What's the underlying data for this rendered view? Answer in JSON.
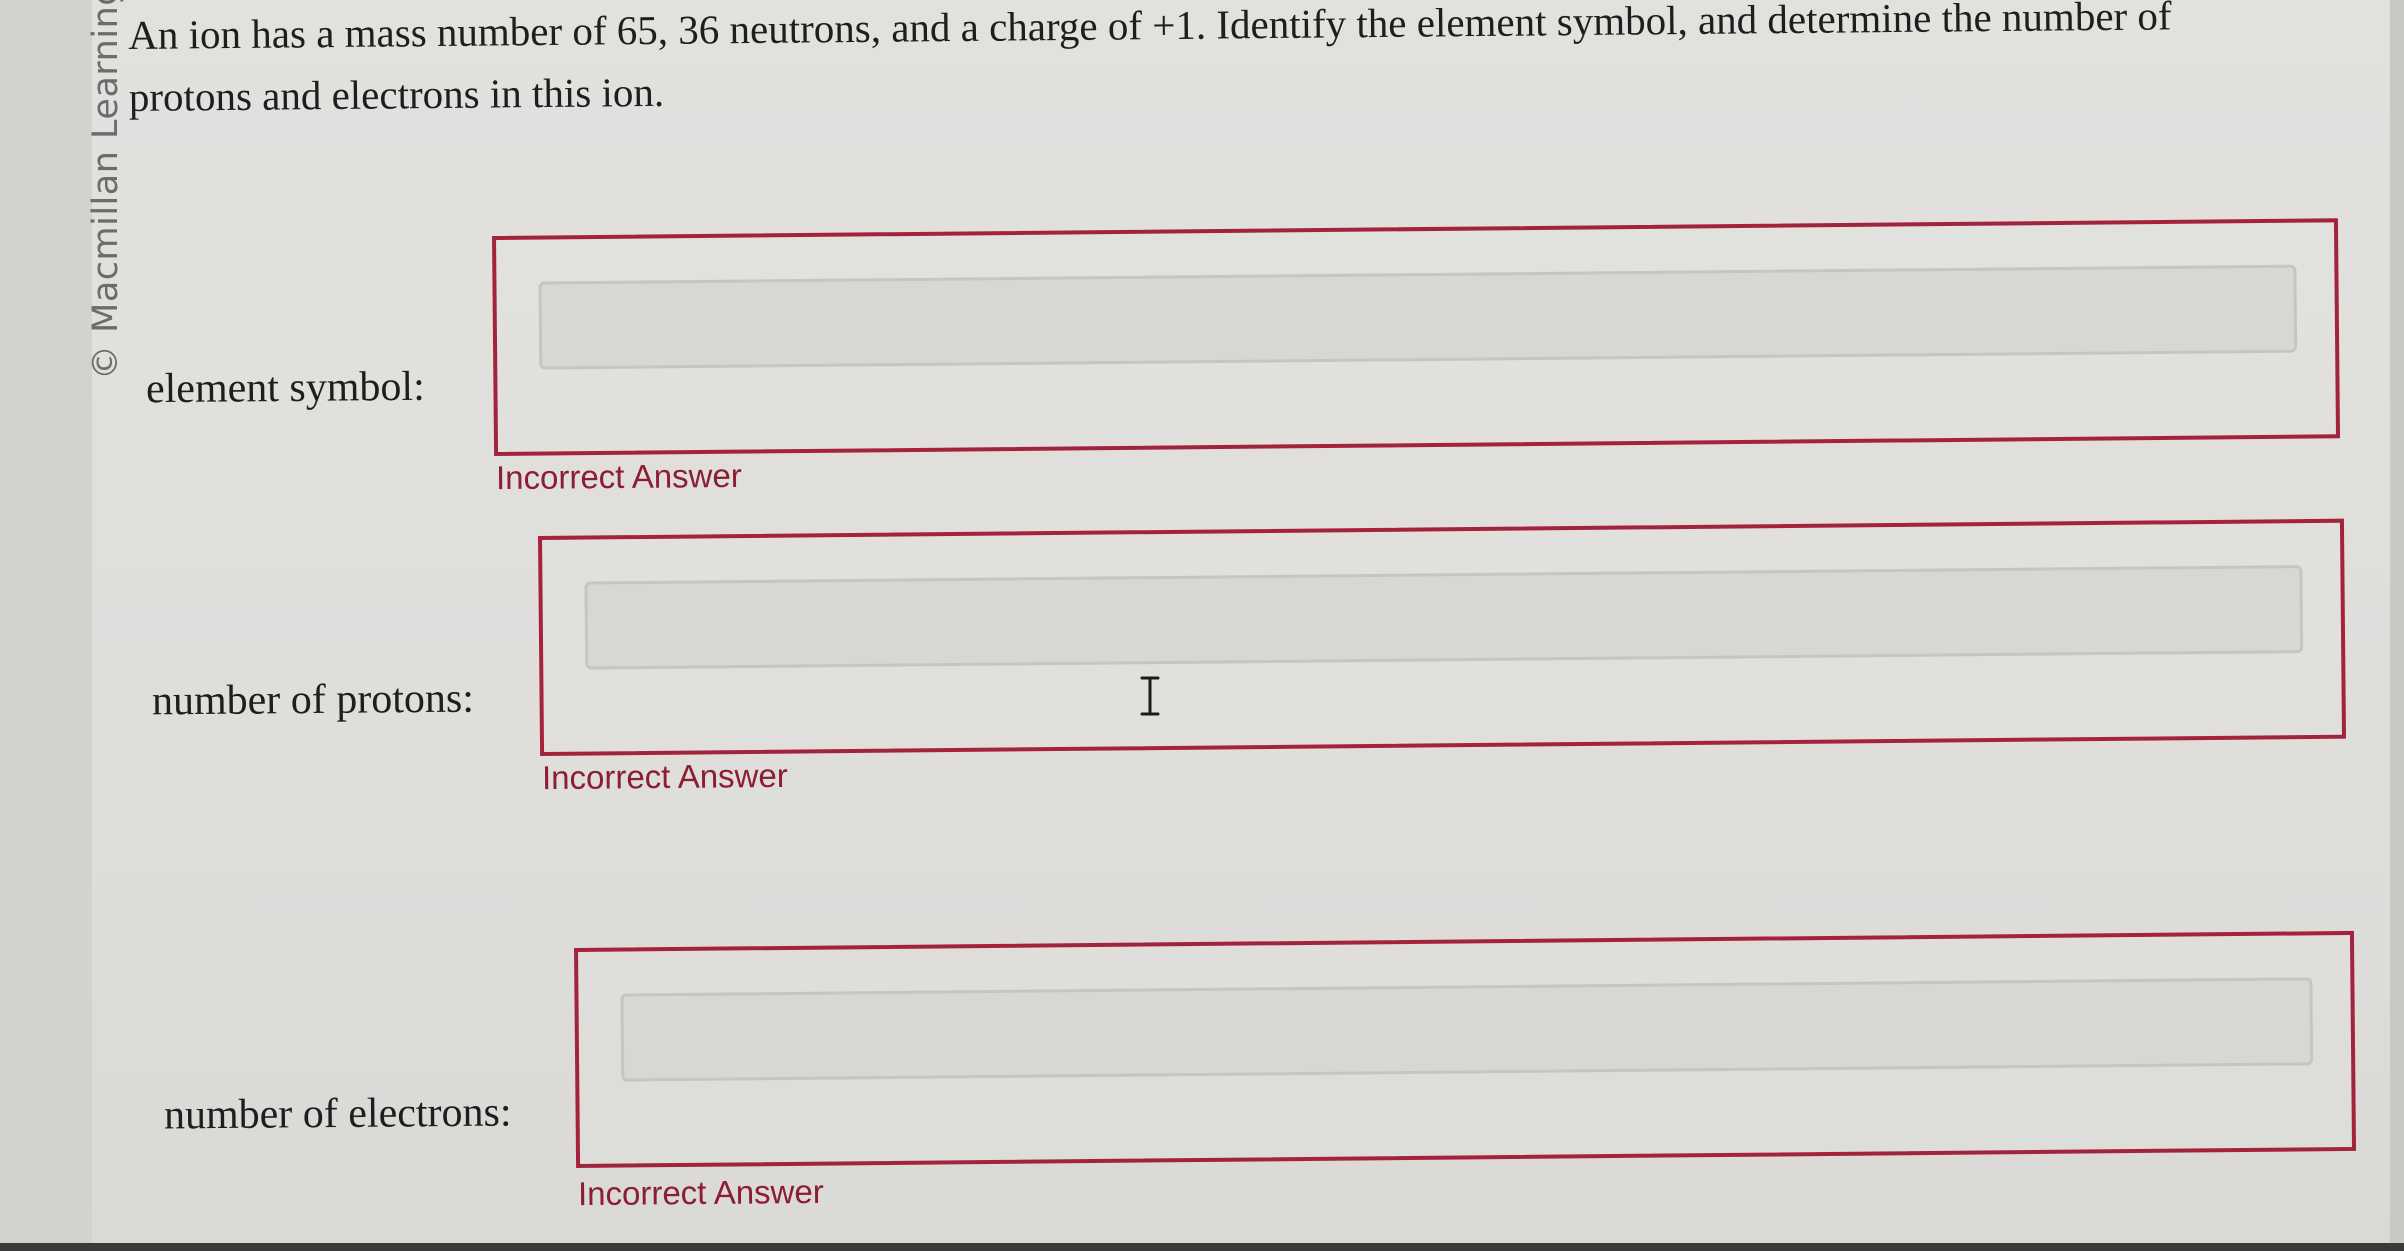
{
  "watermark": "© Macmillan Learning",
  "question": {
    "line1": "An ion has a mass number of 65, 36 neutrons, and a charge of +1. Identify the element symbol, and determine the number of",
    "line2": "protons and electrons in this ion."
  },
  "fields": [
    {
      "label": "element symbol:",
      "value": "",
      "feedback": "Incorrect Answer"
    },
    {
      "label": "number of protons:",
      "value": "",
      "feedback": "Incorrect Answer"
    },
    {
      "label": "number of electrons:",
      "value": "",
      "feedback": "Incorrect Answer"
    }
  ],
  "colors": {
    "error": "#a3233c",
    "feedback_text": "#8c1d33"
  },
  "icons": {
    "cursor": "text-cursor-icon"
  }
}
